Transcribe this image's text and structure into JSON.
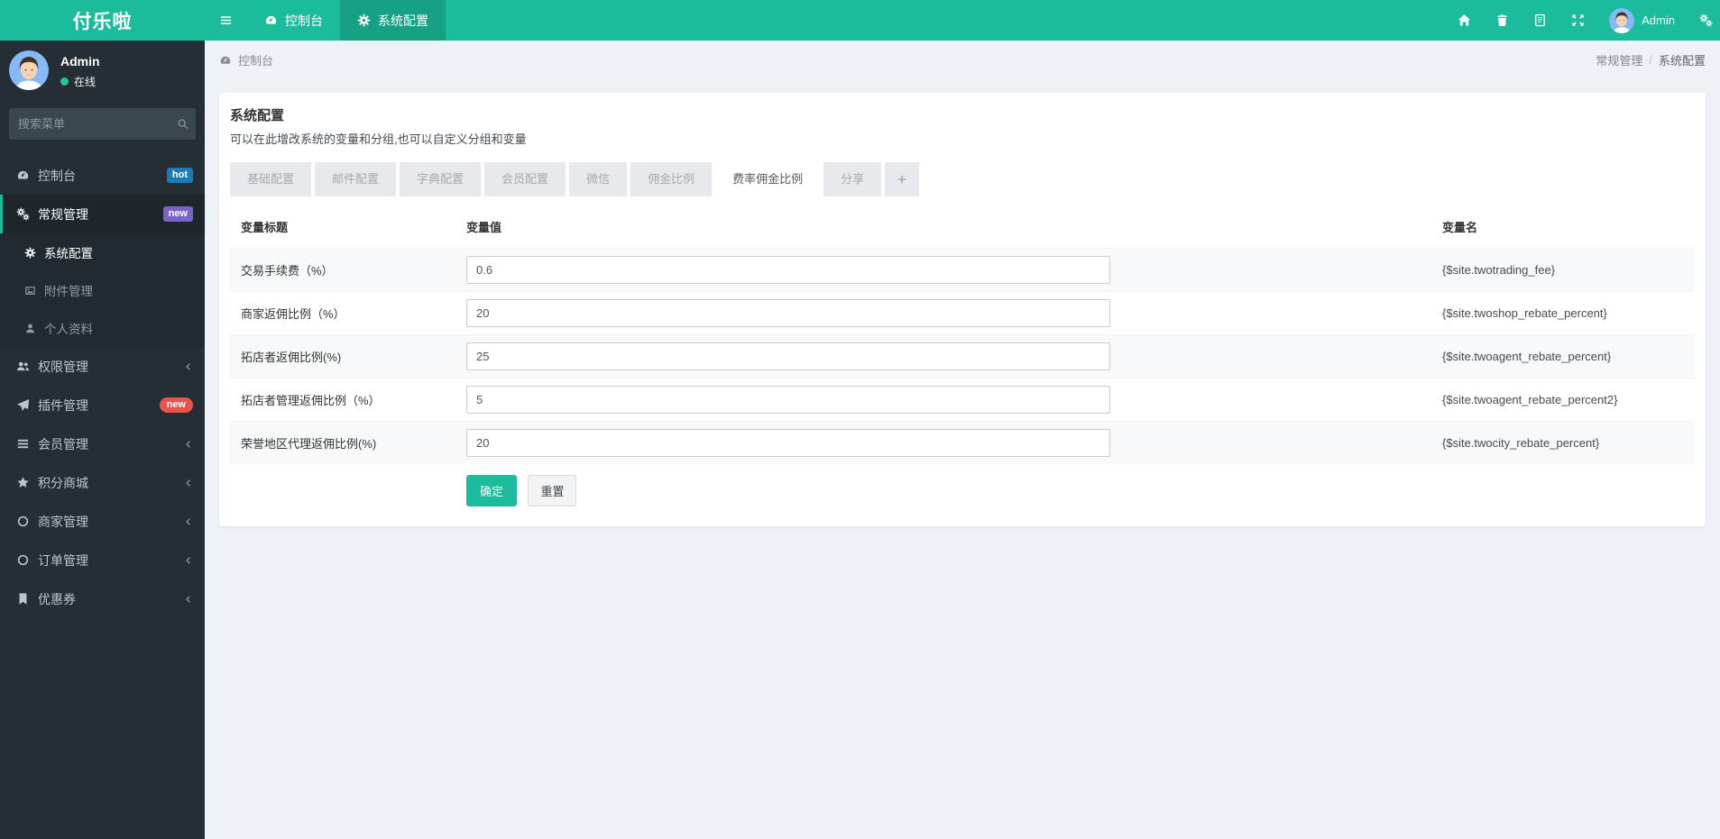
{
  "app": {
    "logo": "付乐啦"
  },
  "navbar": {
    "items": [
      {
        "label": "控制台",
        "icon": "dashboard-icon"
      },
      {
        "label": "系统配置",
        "icon": "gear-icon",
        "active": true
      }
    ],
    "right_icons": [
      "home-icon",
      "trash-icon",
      "log-icon",
      "expand-icon",
      "gears-icon"
    ],
    "user": {
      "name": "Admin"
    }
  },
  "sidebar": {
    "user": {
      "name": "Admin",
      "status": "在线"
    },
    "search_placeholder": "搜索菜单",
    "menu": [
      {
        "label": "控制台",
        "icon": "dashboard-icon",
        "badge": {
          "text": "hot",
          "color": "#1b7cb8"
        }
      },
      {
        "label": "常规管理",
        "icon": "gears-icon",
        "active": true,
        "badge": {
          "text": "new",
          "color": "#7a62c9"
        },
        "children": [
          {
            "label": "系统配置",
            "icon": "gear-icon",
            "active": true
          },
          {
            "label": "附件管理",
            "icon": "image-icon"
          },
          {
            "label": "个人资料",
            "icon": "user-icon"
          }
        ]
      },
      {
        "label": "权限管理",
        "icon": "users-icon",
        "expandable": true
      },
      {
        "label": "插件管理",
        "icon": "plane-icon",
        "badge": {
          "text": "new",
          "color": "#ea5348",
          "pill": true
        }
      },
      {
        "label": "会员管理",
        "icon": "list-icon",
        "expandable": true
      },
      {
        "label": "积分商城",
        "icon": "star-icon",
        "expandable": true
      },
      {
        "label": "商家管理",
        "icon": "circle-icon",
        "expandable": true
      },
      {
        "label": "订单管理",
        "icon": "circle-icon",
        "expandable": true
      },
      {
        "label": "优惠券",
        "icon": "bookmark-icon",
        "expandable": true
      }
    ]
  },
  "breadcrumb": {
    "left": "控制台",
    "parent": "常规管理",
    "separator": "/",
    "current": "系统配置"
  },
  "panel": {
    "title": "系统配置",
    "subtitle": "可以在此增改系统的变量和分组,也可以自定义分组和变量",
    "tabs": [
      {
        "label": "基础配置"
      },
      {
        "label": "邮件配置"
      },
      {
        "label": "字典配置"
      },
      {
        "label": "会员配置"
      },
      {
        "label": "微信"
      },
      {
        "label": "佣金比例"
      },
      {
        "label": "费率佣金比例",
        "active": true
      },
      {
        "label": "分享"
      }
    ],
    "table": {
      "headers": [
        "变量标题",
        "变量值",
        "变量名"
      ],
      "rows": [
        {
          "label": "交易手续费（%）",
          "value": "0.6",
          "var_name": "{$site.twotrading_fee}"
        },
        {
          "label": "商家返佣比例（%）",
          "value": "20",
          "var_name": "{$site.twoshop_rebate_percent}"
        },
        {
          "label": "拓店者返佣比例(%)",
          "value": "25",
          "var_name": "{$site.twoagent_rebate_percent}"
        },
        {
          "label": "拓店者管理返佣比例（%）",
          "value": "5",
          "var_name": "{$site.twoagent_rebate_percent2}"
        },
        {
          "label": "荣誉地区代理返佣比例(%)",
          "value": "20",
          "var_name": "{$site.twocity_rebate_percent}"
        }
      ]
    },
    "buttons": {
      "confirm": "确定",
      "reset": "重置"
    }
  },
  "colors": {
    "accent": "#1abc9c",
    "sidebar_bg": "#252e34",
    "badge_hot": "#1b7cb8",
    "badge_new_purple": "#7a62c9",
    "badge_new_red": "#ea5348",
    "online_dot": "#23c98e",
    "content_bg": "#eef1f5"
  }
}
